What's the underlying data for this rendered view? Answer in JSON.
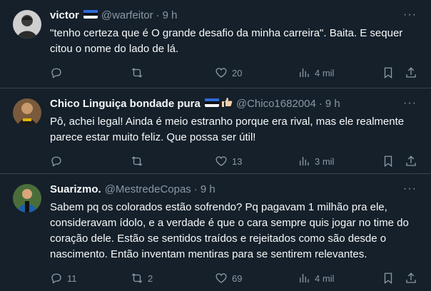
{
  "tweets": [
    {
      "name": "victor",
      "handle": "@warfeitor",
      "time": "9 h",
      "text": "\"tenho certeza que é O grande desafio da minha carreira\". Baita. E sequer citou o nome do lado de lá.",
      "replies": "",
      "retweets": "",
      "likes": "20",
      "views": "4 mil"
    },
    {
      "name": "Chico Linguiça bondade pura",
      "handle": "@Chico1682004",
      "time": "9 h",
      "text": "Pô, achei legal! Ainda é meio estranho porque era rival, mas ele realmente parece estar muito feliz. Que possa ser útil!",
      "replies": "",
      "retweets": "",
      "likes": "13",
      "views": "3 mil"
    },
    {
      "name": "Suarizmo.",
      "handle": "@MestredeCopas",
      "time": "9 h",
      "text": "Sabem pq os colorados estão sofrendo? Pq pagavam 1 milhão pra ele, consideravam ídolo, e a verdade é que o cara sempre quis jogar no time do coração dele. Estão se sentidos traídos e rejeitados como são desde o nascimento. Então inventam mentiras para se sentirem relevantes.",
      "replies": "11",
      "retweets": "2",
      "likes": "69",
      "views": "4 mil"
    }
  ],
  "ui": {
    "dot": "·",
    "more": "···"
  },
  "colors": {
    "background": "#15202b",
    "border": "#38444d",
    "muted": "#8b98a5",
    "text": "#f7f9f9"
  }
}
